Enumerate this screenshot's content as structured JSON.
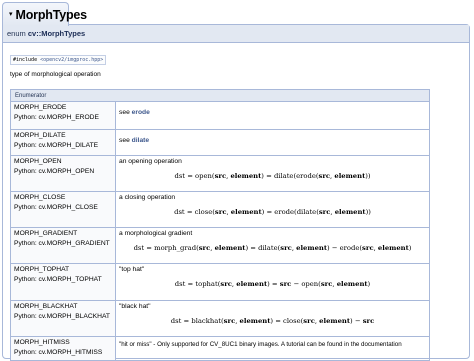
{
  "title": {
    "collapse_icon": "▾",
    "text": "MorphTypes"
  },
  "prototype": {
    "keyword": "enum ",
    "name": "cv::MorphTypes"
  },
  "include": {
    "directive": "#include ",
    "file": "<opencv2/imgproc.hpp>"
  },
  "brief": "type of morphological operation",
  "table": {
    "header": "Enumerator",
    "rows": [
      {
        "name": "MORPH_ERODE",
        "python": "Python: cv.MORPH_ERODE",
        "desc_prefix": "see ",
        "link": "erode",
        "formula": ""
      },
      {
        "name": "MORPH_DILATE",
        "python": "Python: cv.MORPH_DILATE",
        "desc_prefix": "see ",
        "link": "dilate",
        "formula": ""
      },
      {
        "name": "MORPH_OPEN",
        "python": "Python: cv.MORPH_OPEN",
        "desc_prefix": "an opening operation",
        "link": "",
        "formula": "dst = open(src, element) = dilate(erode(src, element))"
      },
      {
        "name": "MORPH_CLOSE",
        "python": "Python: cv.MORPH_CLOSE",
        "desc_prefix": "a closing operation",
        "link": "",
        "formula": "dst = close(src, element) = erode(dilate(src, element))"
      },
      {
        "name": "MORPH_GRADIENT",
        "python": "Python: cv.MORPH_GRADIENT",
        "desc_prefix": "a morphological gradient",
        "link": "",
        "formula": "dst = morph_grad(src, element) = dilate(src, element) − erode(src, element)"
      },
      {
        "name": "MORPH_TOPHAT",
        "python": "Python: cv.MORPH_TOPHAT",
        "desc_prefix": "\"top hat\"",
        "link": "",
        "formula": "dst = tophat(src, element) = src − open(src, element)"
      },
      {
        "name": "MORPH_BLACKHAT",
        "python": "Python: cv.MORPH_BLACKHAT",
        "desc_prefix": "\"black hat\"",
        "link": "",
        "formula": "dst = blackhat(src, element) = close(src, element) − src"
      },
      {
        "name": "MORPH_HITMISS",
        "python": "Python: cv.MORPH_HITMISS",
        "desc_prefix": "\"hit or miss\"  - Only supported for CV_8UC1 binary images. A tutorial can be found in the documentation",
        "link": "",
        "formula": ""
      }
    ]
  }
}
